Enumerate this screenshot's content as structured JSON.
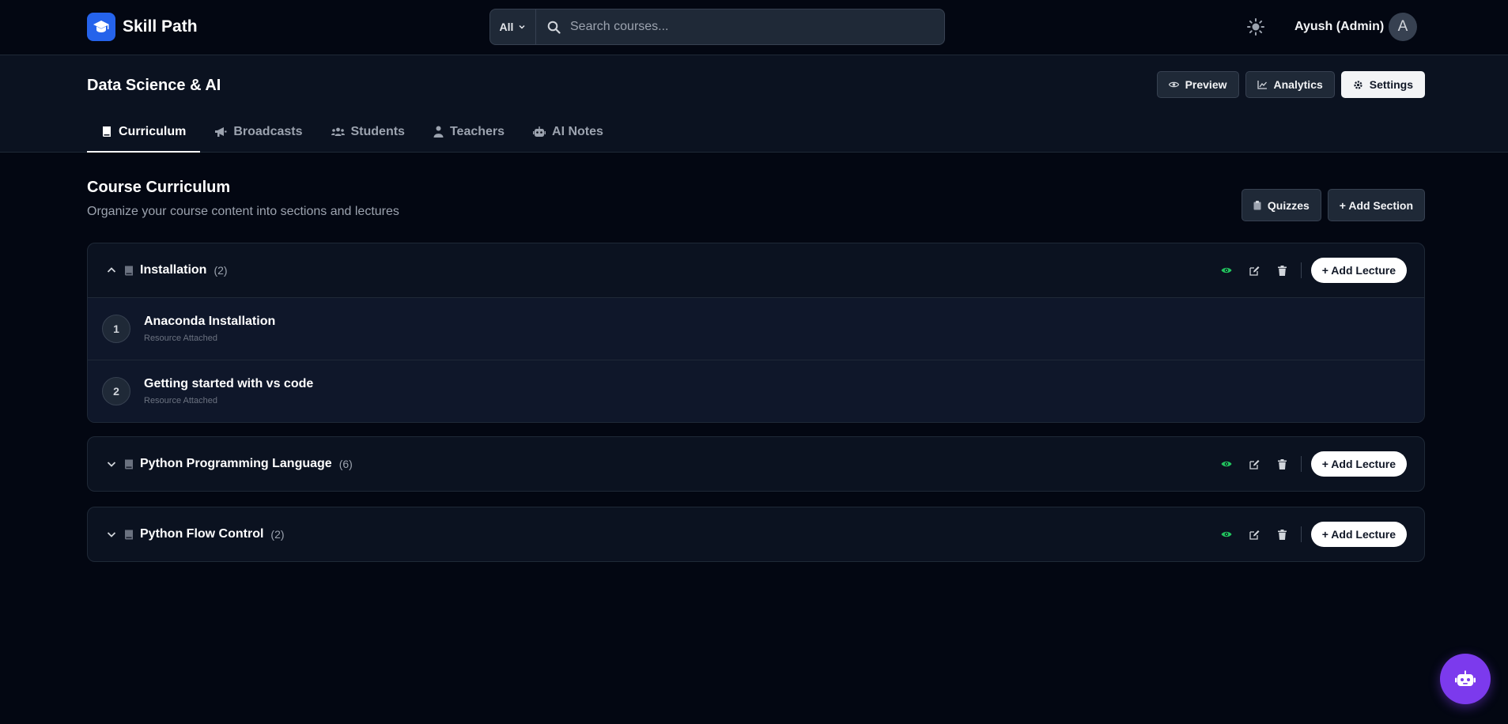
{
  "brand": {
    "name": "Skill Path"
  },
  "search": {
    "filter": "All",
    "placeholder": "Search courses..."
  },
  "user": {
    "name": "Ayush (Admin)",
    "avatar_initial": "A"
  },
  "course": {
    "title": "Data Science & AI",
    "actions": {
      "preview": "Preview",
      "analytics": "Analytics",
      "settings": "Settings"
    }
  },
  "tabs": [
    {
      "label": "Curriculum",
      "active": true
    },
    {
      "label": "Broadcasts"
    },
    {
      "label": "Students"
    },
    {
      "label": "Teachers"
    },
    {
      "label": "AI Notes"
    }
  ],
  "curriculum": {
    "title": "Course Curriculum",
    "subtitle": "Organize your course content into sections and lectures",
    "quizzes_label": "Quizzes",
    "add_section_label": "+ Add Section",
    "add_lecture_label": "+ Add Lecture",
    "sections": [
      {
        "name": "Installation",
        "count": "(2)",
        "expanded": true,
        "lectures": [
          {
            "num": "1",
            "title": "Anaconda Installation",
            "meta": "Resource Attached"
          },
          {
            "num": "2",
            "title": "Getting started with vs code",
            "meta": "Resource Attached"
          }
        ]
      },
      {
        "name": "Python Programming Language",
        "count": "(6)",
        "expanded": false
      },
      {
        "name": "Python Flow Control",
        "count": "(2)",
        "expanded": false
      }
    ]
  },
  "colors": {
    "brand": "#2563eb",
    "visible": "#22c55e",
    "fab": "#7c3aed",
    "background": "#030712"
  }
}
